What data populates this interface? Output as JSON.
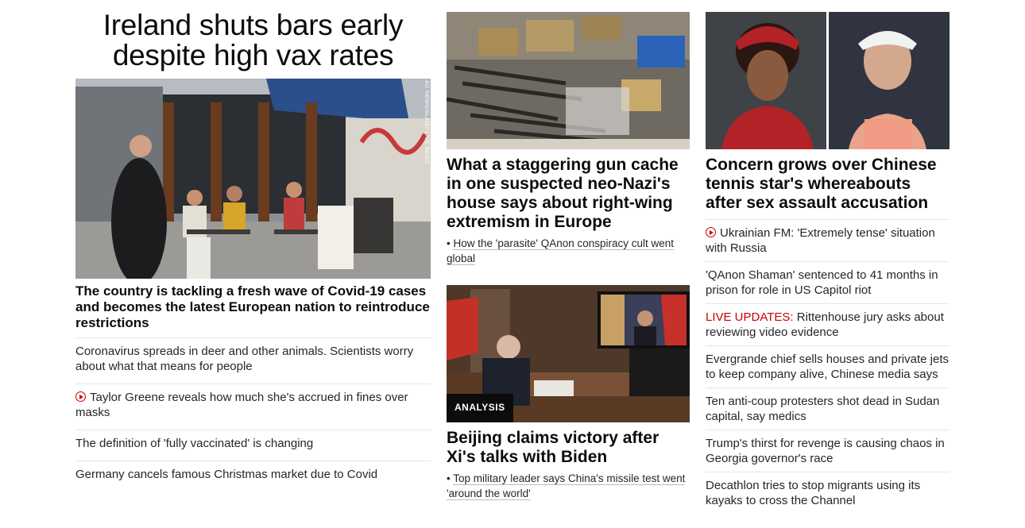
{
  "left": {
    "headline": "Ireland shuts bars early despite high vax rates",
    "image_credit": "AG NEWS/ALAMY LIVE NEWS",
    "summary": "The country is tackling a fresh wave of Covid-19 cases and becomes the latest European nation to reintroduce restrictions",
    "links": [
      {
        "text": "Coronavirus spreads in deer and other animals. Scientists worry about what that means for people",
        "video": false
      },
      {
        "text": "Taylor Greene reveals how much she's accrued in fines over masks",
        "video": true
      },
      {
        "text": "The definition of 'fully vaccinated' is changing",
        "video": false
      },
      {
        "text": "Germany cancels famous Christmas market due to Covid",
        "video": false
      }
    ]
  },
  "middle": {
    "story1": {
      "title": "What a staggering gun cache in one suspected neo-Nazi's house says about right-wing extremism in Europe",
      "related": "How the 'parasite' QAnon conspiracy cult went global"
    },
    "story2": {
      "badge": "ANALYSIS",
      "title": "Beijing claims victory after Xi's talks with Biden",
      "related": "Top military leader says China's missile test went 'around the world'"
    }
  },
  "right": {
    "title": "Concern grows over Chinese tennis star's whereabouts after sex assault accusation",
    "links": [
      {
        "text": "Ukrainian FM: 'Extremely tense' situation with Russia",
        "video": true,
        "prefix": ""
      },
      {
        "text": "'QAnon Shaman' sentenced to 41 months in prison for role in US Capitol riot",
        "video": false,
        "prefix": ""
      },
      {
        "text": "Rittenhouse jury asks about reviewing video evidence",
        "video": false,
        "prefix": "LIVE UPDATES:"
      },
      {
        "text": "Evergrande chief sells houses and private jets to keep company alive, Chinese media says",
        "video": false,
        "prefix": ""
      },
      {
        "text": "Ten anti-coup protesters shot dead in Sudan capital, say medics",
        "video": false,
        "prefix": ""
      },
      {
        "text": "Trump's thirst for revenge is causing chaos in Georgia governor's race",
        "video": false,
        "prefix": ""
      },
      {
        "text": "Decathlon tries to stop migrants using its kayaks to cross the Channel",
        "video": false,
        "prefix": ""
      }
    ]
  },
  "colors": {
    "accent_red": "#cc0000",
    "text": "#262626",
    "divider": "#e6e6e6"
  }
}
